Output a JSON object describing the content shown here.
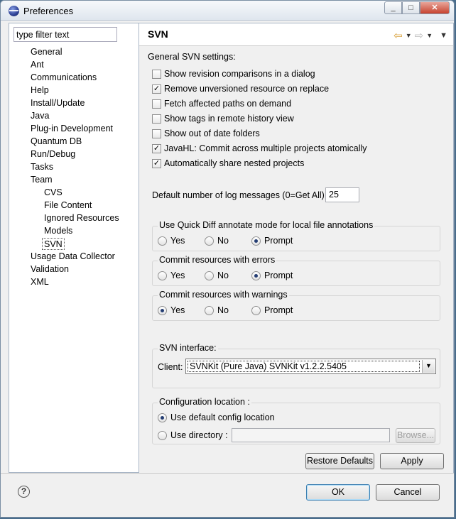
{
  "window": {
    "title": "Preferences",
    "min": "_",
    "max": "□",
    "close": "✕"
  },
  "filter": {
    "value": "type filter text"
  },
  "tree": [
    {
      "label": "General"
    },
    {
      "label": "Ant"
    },
    {
      "label": "Communications"
    },
    {
      "label": "Help"
    },
    {
      "label": "Install/Update"
    },
    {
      "label": "Java"
    },
    {
      "label": "Plug-in Development"
    },
    {
      "label": "Quantum DB"
    },
    {
      "label": "Run/Debug"
    },
    {
      "label": "Tasks"
    },
    {
      "label": "Team"
    },
    {
      "label": "CVS"
    },
    {
      "label": "File Content"
    },
    {
      "label": "Ignored Resources"
    },
    {
      "label": "Models"
    },
    {
      "label": "SVN"
    },
    {
      "label": "Usage Data Collector"
    },
    {
      "label": "Validation"
    },
    {
      "label": "XML"
    }
  ],
  "page": {
    "title": "SVN",
    "general_label": "General SVN settings:",
    "checkboxes": [
      {
        "label": "Show revision comparisons in a dialog",
        "checked": false
      },
      {
        "label": "Remove unversioned resource on replace",
        "checked": true
      },
      {
        "label": "Fetch affected paths on demand",
        "checked": false
      },
      {
        "label": "Show tags in remote history view",
        "checked": false
      },
      {
        "label": "Show out of date folders",
        "checked": false
      },
      {
        "label": "JavaHL: Commit across multiple projects atomically",
        "checked": true
      },
      {
        "label": "Automatically share nested projects",
        "checked": true
      }
    ],
    "log_label": "Default number of log messages (0=Get All)",
    "log_value": "25",
    "groups": [
      {
        "title": "Use Quick Diff annotate mode for local file annotations",
        "options": [
          "Yes",
          "No",
          "Prompt"
        ],
        "selected": "Prompt"
      },
      {
        "title": "Commit resources with errors",
        "options": [
          "Yes",
          "No",
          "Prompt"
        ],
        "selected": "Prompt"
      },
      {
        "title": "Commit resources with warnings",
        "options": [
          "Yes",
          "No",
          "Prompt"
        ],
        "selected": "Yes"
      }
    ],
    "interface": {
      "title": "SVN interface:",
      "client_label": "Client:",
      "client_value": "SVNKit (Pure Java) SVNKit v1.2.2.5405"
    },
    "config": {
      "title": "Configuration location :",
      "use_default": "Use default config location",
      "use_directory": "Use directory :",
      "browse": "Browse...",
      "selected": "default"
    },
    "restore_defaults": "Restore Defaults",
    "apply": "Apply"
  },
  "footer": {
    "help": "?",
    "ok": "OK",
    "cancel": "Cancel"
  }
}
